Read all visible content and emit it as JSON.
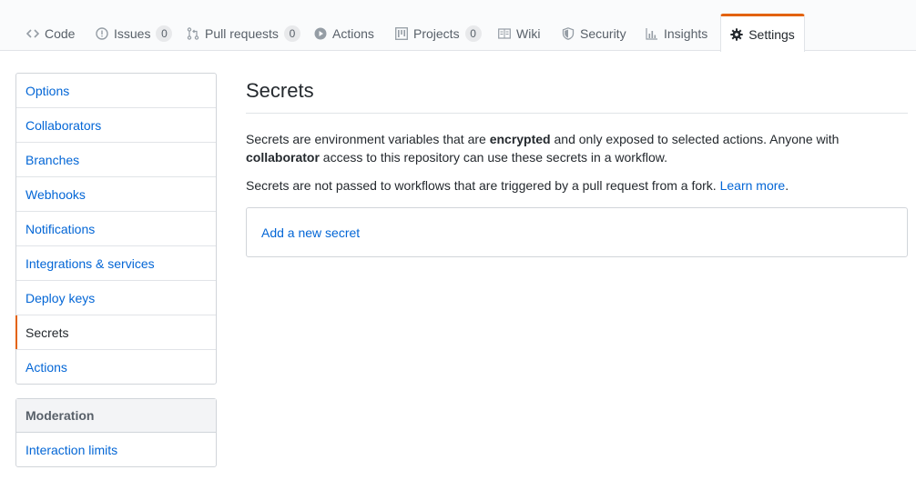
{
  "repo_nav": {
    "tabs": [
      {
        "label": "Code",
        "icon": "code-icon"
      },
      {
        "label": "Issues",
        "icon": "issue-icon",
        "counter": "0"
      },
      {
        "label": "Pull requests",
        "icon": "pull-request-icon",
        "counter": "0"
      },
      {
        "label": "Actions",
        "icon": "play-icon"
      },
      {
        "label": "Projects",
        "icon": "project-icon",
        "counter": "0"
      },
      {
        "label": "Wiki",
        "icon": "book-icon"
      },
      {
        "label": "Security",
        "icon": "shield-icon"
      },
      {
        "label": "Insights",
        "icon": "graph-icon"
      },
      {
        "label": "Settings",
        "icon": "gear-icon",
        "selected": true
      }
    ]
  },
  "sidebar": {
    "items": [
      {
        "label": "Options"
      },
      {
        "label": "Collaborators"
      },
      {
        "label": "Branches"
      },
      {
        "label": "Webhooks"
      },
      {
        "label": "Notifications"
      },
      {
        "label": "Integrations & services"
      },
      {
        "label": "Deploy keys"
      },
      {
        "label": "Secrets",
        "selected": true
      },
      {
        "label": "Actions"
      }
    ],
    "moderation": {
      "heading": "Moderation",
      "items": [
        {
          "label": "Interaction limits"
        }
      ]
    }
  },
  "main": {
    "title": "Secrets",
    "description": {
      "part1": "Secrets are environment variables that are ",
      "bold1": "encrypted",
      "part2": " and only exposed to selected actions. Anyone with ",
      "bold2": "collaborator",
      "part3": " access to this repository can use these secrets in a workflow."
    },
    "fork_note": "Secrets are not passed to workflows that are triggered by a pull request from a fork. ",
    "learn_more": "Learn more",
    "fork_note_end": ".",
    "add_secret": "Add a new secret"
  },
  "colors": {
    "accent": "#e36209",
    "link": "#0366d6",
    "text": "#24292e",
    "muted": "#586069"
  }
}
